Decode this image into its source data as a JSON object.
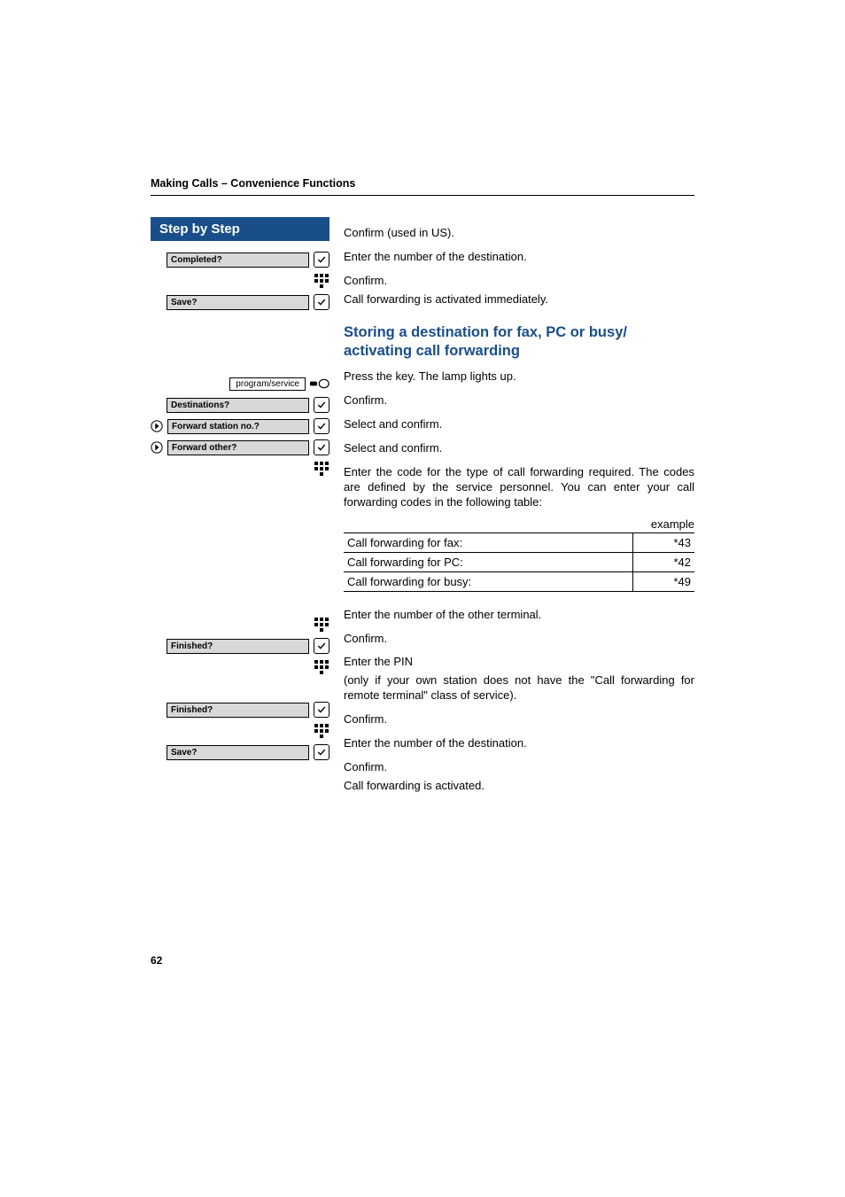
{
  "runningHead": "Making Calls – Convenience Functions",
  "stepHeader": "Step by Step",
  "left": {
    "completed": "Completed?",
    "save1": "Save?",
    "programService": "program/service",
    "destinations": "Destinations?",
    "forwardStation": "Forward station no.?",
    "forwardOther": "Forward other?",
    "finished1": "Finished?",
    "finished2": "Finished?",
    "save2": "Save?"
  },
  "right": {
    "confirmUS": "Confirm (used in US).",
    "enterDest1": "Enter the number of the destination.",
    "confirm1": "Confirm.",
    "fwdActivatedImm": "Call forwarding is activated immediately.",
    "sectionTitle": "Storing a destination for fax, PC or busy/\nactivating call forwarding",
    "pressKey": "Press the key. The lamp lights up.",
    "confirm2": "Confirm.",
    "selectConfirm1": "Select and confirm.",
    "selectConfirm2": "Select and confirm.",
    "enterCode": "Enter the code for the type of call forwarding required. The codes are defined by the service personnel. You can enter your call forwarding codes in the following table:",
    "exampleLabel": "example",
    "table": [
      {
        "label": "Call forwarding for fax:",
        "code": "*43"
      },
      {
        "label": "Call forwarding for PC:",
        "code": "*42"
      },
      {
        "label": "Call forwarding for busy:",
        "code": "*49"
      }
    ],
    "enterOther": "Enter the number of the other terminal.",
    "confirm3": "Confirm.",
    "enterPin1": "Enter the PIN",
    "enterPin2": "(only if your own station does not have the \"Call forwarding for remote terminal\" class of service).",
    "confirm4": "Confirm.",
    "enterDest2": "Enter the number of the destination.",
    "confirm5": "Confirm.",
    "fwdActivated": "Call forwarding is activated."
  },
  "pageNumber": "62"
}
